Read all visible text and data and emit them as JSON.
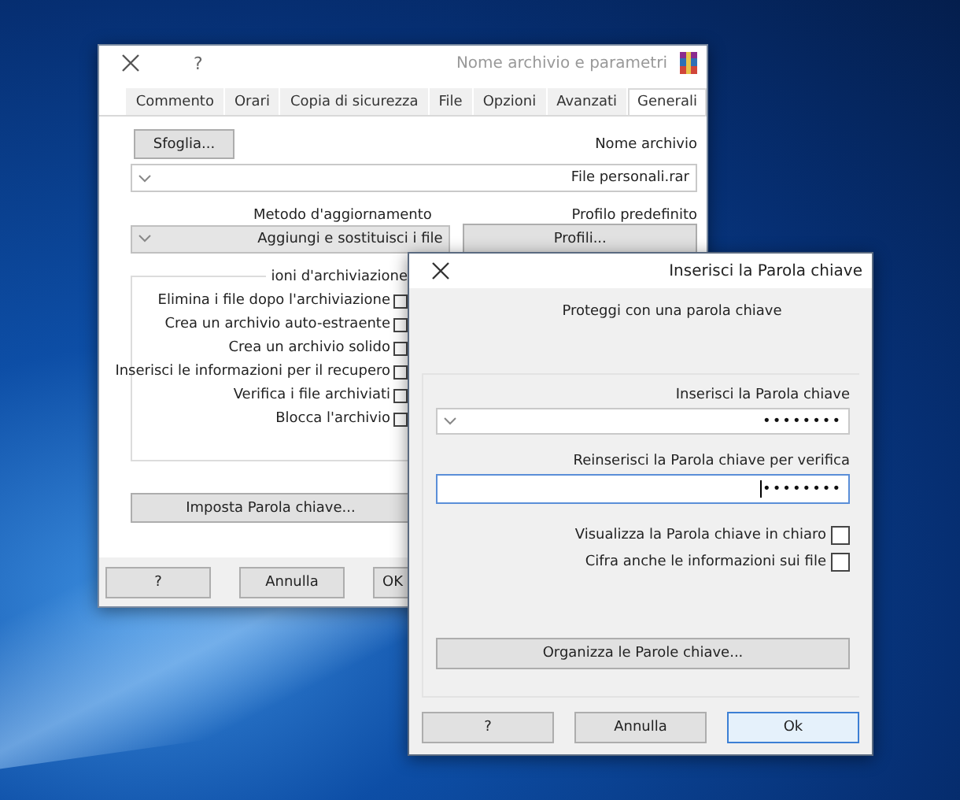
{
  "main_dialog": {
    "title": "Nome archivio e parametri",
    "help_glyph": "?",
    "tabs": [
      {
        "label": "Commento",
        "selected": false
      },
      {
        "label": "Orari",
        "selected": false
      },
      {
        "label": "Copia di sicurezza",
        "selected": false
      },
      {
        "label": "File",
        "selected": false
      },
      {
        "label": "Opzioni",
        "selected": false
      },
      {
        "label": "Avanzati",
        "selected": false
      },
      {
        "label": "Generali",
        "selected": true
      }
    ],
    "archive_name_label": "Nome archivio",
    "browse_button": "Sfoglia...",
    "archive_name_value": "File personali.rar",
    "profile_label": "Profilo predefinito",
    "profiles_button": "Profili...",
    "update_method_label": "Metodo d'aggiornamento",
    "update_method_value": "Aggiungi e sostituisci i file",
    "options_group_title": "ioni d'archiviazione",
    "options": [
      {
        "label": "Elimina i file dopo l'archiviazione",
        "checked": false
      },
      {
        "label": "Crea un archivio auto-estraente",
        "checked": false
      },
      {
        "label": "Crea un archivio solido",
        "checked": false
      },
      {
        "label": "Inserisci le informazioni per il recupero",
        "checked": false
      },
      {
        "label": "Verifica i file archiviati",
        "checked": false
      },
      {
        "label": "Blocca l'archivio",
        "checked": false
      }
    ],
    "set_password_button": "Imposta Parola chiave...",
    "buttons": [
      "?",
      "Annulla",
      "OK"
    ]
  },
  "password_dialog": {
    "title": "Inserisci la Parola chiave",
    "heading": "Proteggi con una parola chiave",
    "password_label": "Inserisci la Parola chiave",
    "password_value": "••••••••",
    "confirm_label": "Reinserisci la Parola chiave per verifica",
    "confirm_value": "••••••••",
    "options": [
      {
        "label": "Visualizza la Parola chiave in chiaro",
        "checked": false
      },
      {
        "label": "Cifra anche le informazioni sui file",
        "checked": false
      }
    ],
    "organize_button": "Organizza le Parole chiave...",
    "buttons": [
      "?",
      "Annulla",
      "Ok"
    ]
  }
}
